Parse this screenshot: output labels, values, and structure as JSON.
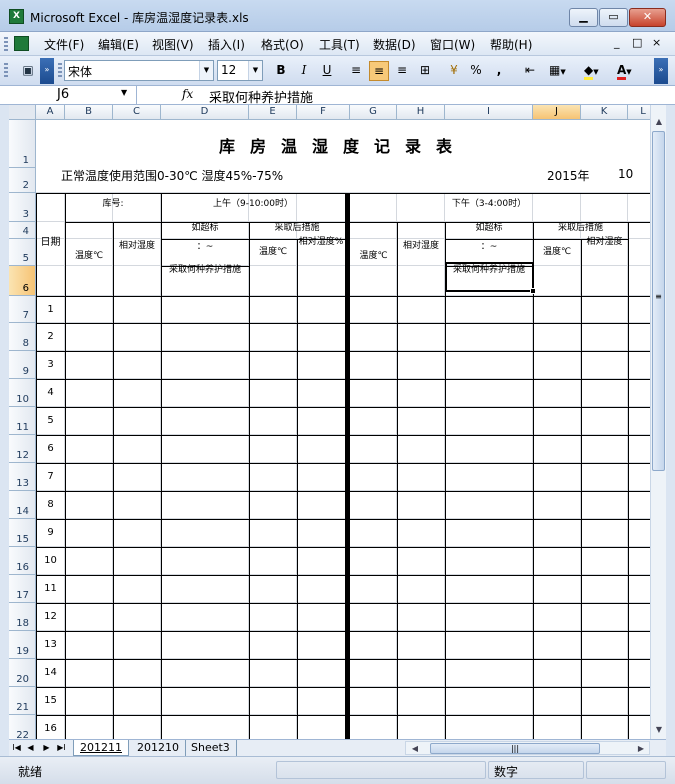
{
  "window": {
    "title": "Microsoft Excel - 库房温湿度记录表.xls",
    "app_badge": "X"
  },
  "menu": {
    "items": [
      "文件(F)",
      "编辑(E)",
      "视图(V)",
      "插入(I)",
      "格式(O)",
      "工具(T)",
      "数据(D)",
      "窗口(W)",
      "帮助(H)"
    ],
    "doc_controls": [
      "_",
      "□",
      "×"
    ]
  },
  "toolbar": {
    "font_name": "宋体",
    "font_size": "12",
    "bold": "B",
    "italic": "I",
    "underline": "U",
    "percent": "%",
    "comma": ","
  },
  "formula_bar": {
    "name_box": "J6",
    "fx": "fx",
    "value": "采取何种养护措施"
  },
  "columns": [
    "A",
    "B",
    "C",
    "D",
    "E",
    "F",
    "G",
    "H",
    "I",
    "J",
    "K",
    "L"
  ],
  "selected_column": "J",
  "selected_row": "6",
  "rows": [
    "1",
    "2",
    "3",
    "4",
    "5",
    "6",
    "7",
    "8",
    "9",
    "10",
    "11",
    "12",
    "13",
    "14",
    "15",
    "16",
    "17",
    "18",
    "19",
    "20",
    "21",
    "22"
  ],
  "sheet": {
    "title": "库房温湿度记录表",
    "subtitle": "正常温度使用范围0-30℃  湿度45%-75%",
    "year": "2015年",
    "month": "10",
    "date_label": "日期",
    "store_no": "库号:",
    "morning": "上午（9-10:00时）",
    "afternoon": "下午（3-4:00时）",
    "temp": "温度℃",
    "humidity": "相对湿度",
    "if_exceed": "如超标",
    "measures_after": "采取后措施",
    "temp_after": "温度℃",
    "humidity_after_am": "相对湿度%",
    "humidity_after_pm": "相对湿度",
    "tilde": "：~",
    "which_measure": "采取何种养护措施",
    "days": [
      "1",
      "2",
      "3",
      "4",
      "5",
      "6",
      "7",
      "8",
      "9",
      "10",
      "11",
      "12",
      "13",
      "14",
      "15",
      "16"
    ]
  },
  "tabs": {
    "nav": [
      "I◀",
      "◀",
      "▶",
      "▶I"
    ],
    "sheets": [
      "201211",
      "201210",
      "Sheet3"
    ],
    "active": "201211"
  },
  "status": {
    "ready": "就绪",
    "num": "数字"
  }
}
